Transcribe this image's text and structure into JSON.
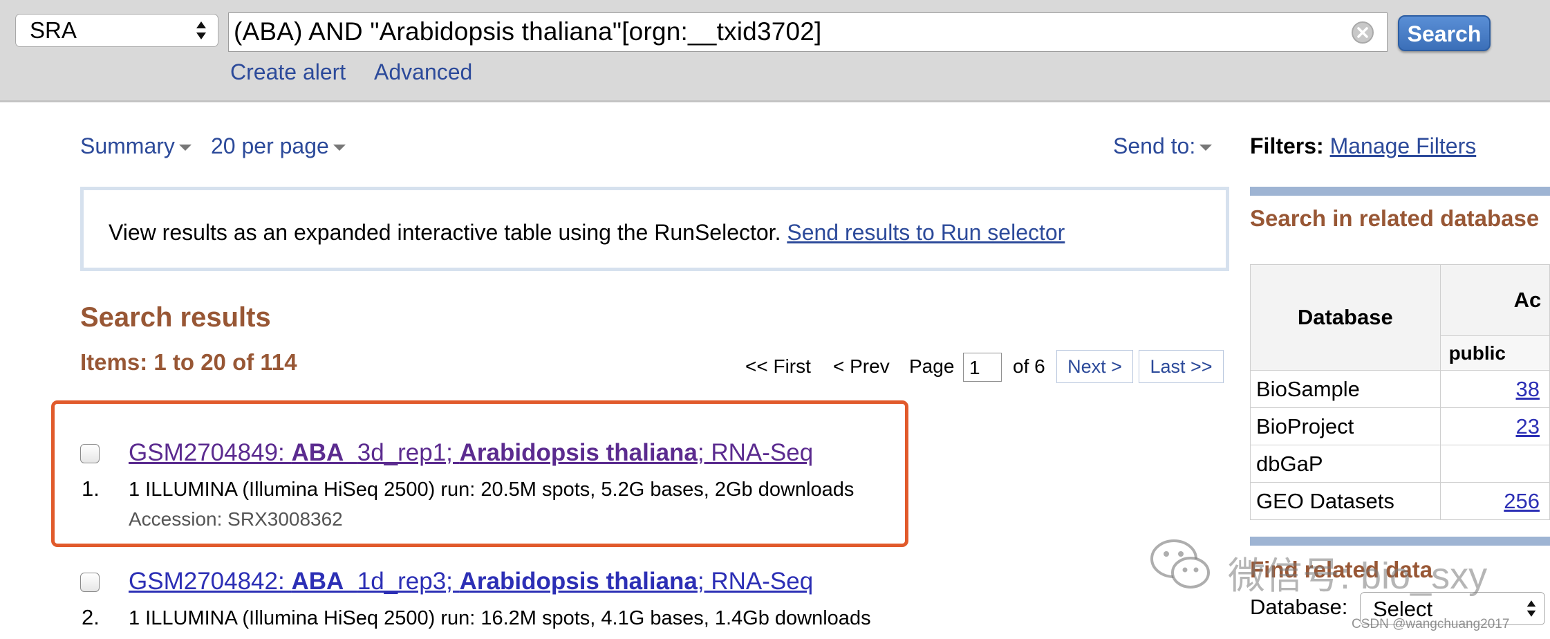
{
  "search": {
    "database": "SRA",
    "query": "(ABA) AND \"Arabidopsis thaliana\"[orgn:__txid3702]",
    "button_label": "Search",
    "links": [
      "Create alert",
      "Advanced"
    ]
  },
  "controls": {
    "format": "Summary",
    "per_page": "20 per page",
    "send_to": "Send to:"
  },
  "notice": {
    "text": "View results as an expanded interactive table using the RunSelector.",
    "link": "Send results to Run selector"
  },
  "results": {
    "heading": "Search results",
    "items_label": "Items: 1 to 20 of 114",
    "pager": {
      "first": "<< First",
      "prev": "< Prev",
      "page_label": "Page",
      "page_value": "1",
      "of_label": "of 6",
      "next": "Next >",
      "last": "Last >>"
    },
    "items": [
      {
        "num": "1.",
        "id": "GSM2704849: ",
        "title_b1": "ABA_",
        "title_mid": "3d_rep1; ",
        "title_b2": "Arabidopsis thaliana",
        "title_end": "; RNA-Seq",
        "desc": "1 ILLUMINA (Illumina HiSeq 2500) run: 20.5M spots, 5.2G bases, 2Gb downloads",
        "accession": "Accession: SRX3008362",
        "highlighted": true
      },
      {
        "num": "2.",
        "id": "GSM2704842: ",
        "title_b1": "ABA_",
        "title_mid": "1d_rep3; ",
        "title_b2": "Arabidopsis thaliana",
        "title_end": "; RNA-Seq",
        "desc": "1 ILLUMINA (Illumina HiSeq 2500) run: 16.2M spots, 4.1G bases, 1.4Gb downloads"
      }
    ]
  },
  "sidebar": {
    "filters_label": "Filters:",
    "manage_filters": "Manage Filters",
    "related_heading": "Search in related database",
    "table": {
      "col_database": "Database",
      "col_group": "Ac",
      "col_public": "public",
      "rows": [
        {
          "name": "BioSample",
          "count": "38"
        },
        {
          "name": "BioProject",
          "count": "23"
        },
        {
          "name": "dbGaP",
          "count": ""
        },
        {
          "name": "GEO Datasets",
          "count": "256"
        }
      ]
    },
    "find_related_heading": "Find related data",
    "database_label": "Database:",
    "database_select": "Select"
  },
  "watermarks": {
    "wechat": "微信号: bio_sxy",
    "csdn": "CSDN @wangchuang2017"
  },
  "colors": {
    "link": "#2c4a9a",
    "heading_brown": "#985735",
    "highlight_frame": "#e15a2b",
    "search_button": "#3b6fb8"
  }
}
